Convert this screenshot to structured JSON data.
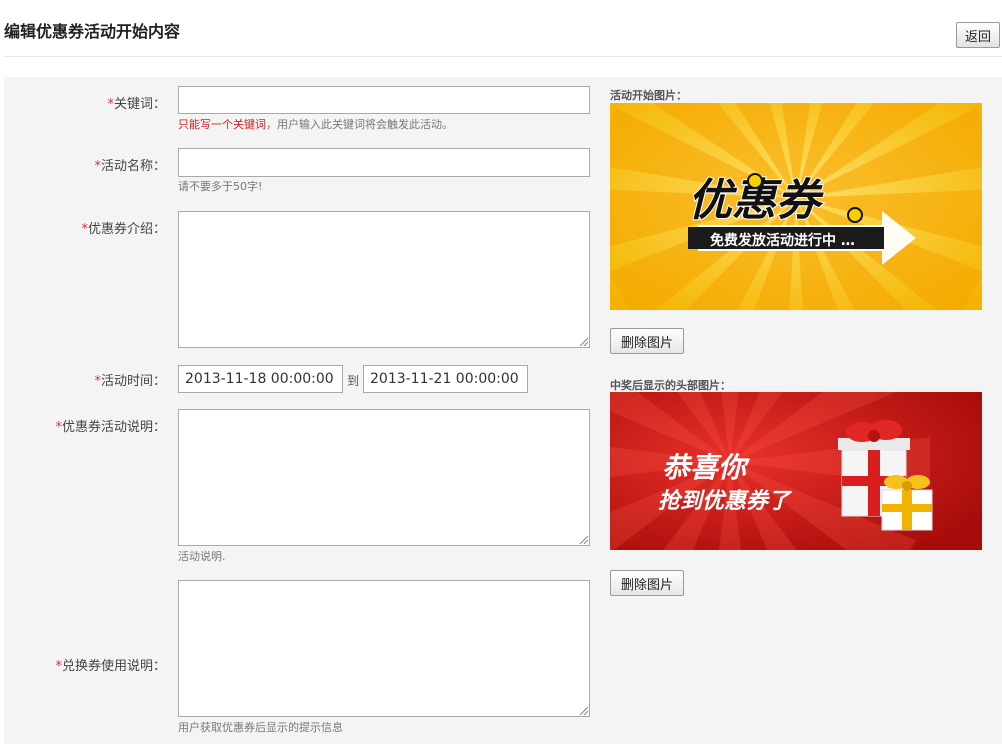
{
  "header": {
    "title": "编辑优惠券活动开始内容",
    "back_label": "返回"
  },
  "form": {
    "required_mark": "*",
    "keyword": {
      "label": "关键词：",
      "value": "",
      "hint_warning": "只能写一个关键词",
      "hint_rest": "，用户输入此关键词将会触发此活动。"
    },
    "activity_name": {
      "label": "活动名称：",
      "value": "",
      "hint": "请不要多于50字!"
    },
    "coupon_intro": {
      "label": "优惠券介绍：",
      "value": ""
    },
    "activity_time": {
      "label": "活动时间：",
      "start": "2013-11-18 00:00:00",
      "to_label": "到",
      "end": "2013-11-21 00:00:00"
    },
    "activity_desc": {
      "label": "优惠券活动说明：",
      "value": "",
      "hint": "活动说明."
    },
    "redeem_desc": {
      "label": "兑换券使用说明：",
      "value": "",
      "hint": "用户获取优惠券后显示的提示信息"
    }
  },
  "sidebar": {
    "start_image": {
      "label": "活动开始图片：",
      "banner_title": "优惠券",
      "banner_subtitle": "免费发放活动进行中 …",
      "delete_label": "删除图片"
    },
    "header_image": {
      "label": "中奖后显示的头部图片：",
      "line1": "恭喜你",
      "line2": "抢到优惠券了",
      "delete_label": "删除图片"
    }
  },
  "colors": {
    "required": "#e03030",
    "panel_bg": "#f4f4f4",
    "start_banner_yellow": "#f6c800",
    "header_banner_red": "#c8140f"
  }
}
